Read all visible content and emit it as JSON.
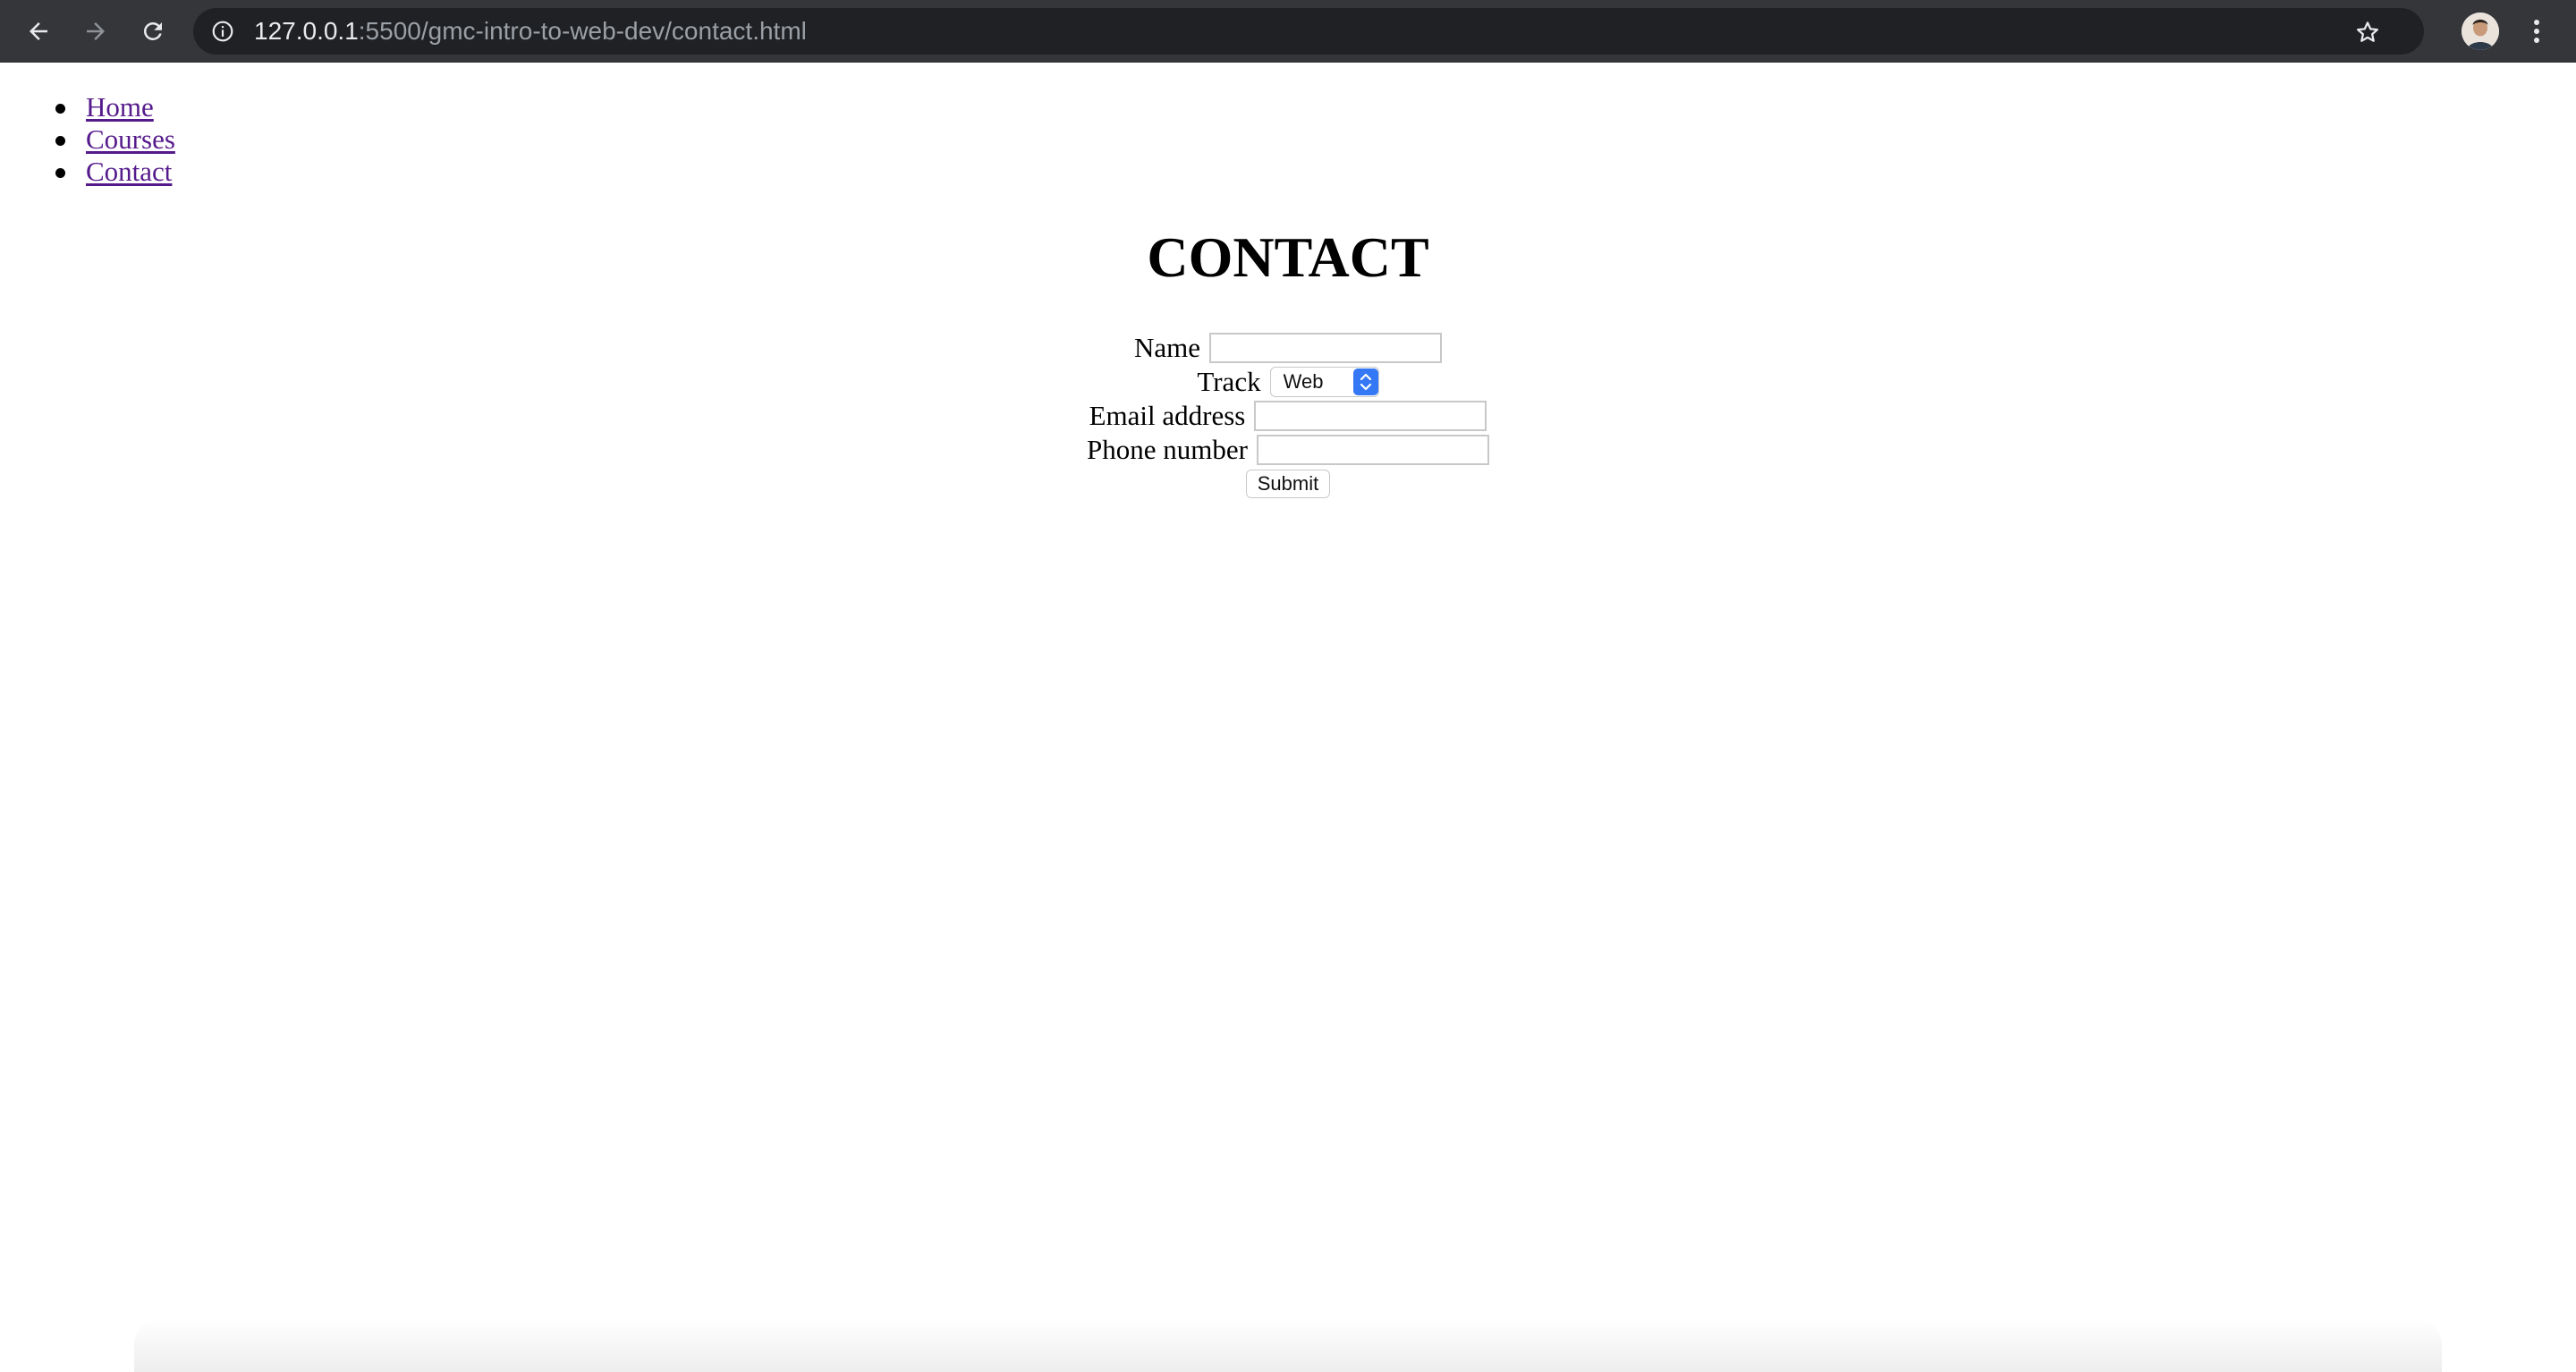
{
  "browser": {
    "url_host": "127.0.0.1",
    "url_rest": ":5500/gmc-intro-to-web-dev/contact.html",
    "icons": {
      "back": "back-arrow-icon",
      "forward": "forward-arrow-icon",
      "reload": "reload-icon",
      "info": "info-icon",
      "bookmark": "star-icon",
      "menu": "kebab-menu-icon"
    }
  },
  "nav": {
    "items": [
      {
        "label": "Home"
      },
      {
        "label": "Courses"
      },
      {
        "label": "Contact"
      }
    ]
  },
  "main": {
    "title": "CONTACT",
    "form": {
      "name_label": "Name",
      "name_value": "",
      "track_label": "Track",
      "track_value": "Web",
      "email_label": "Email address",
      "email_value": "",
      "phone_label": "Phone number",
      "phone_value": "",
      "submit_label": "Submit"
    }
  },
  "colors": {
    "link_visited": "#551a8b",
    "chrome_bg": "#35363a",
    "select_accent": "#3478f6"
  }
}
